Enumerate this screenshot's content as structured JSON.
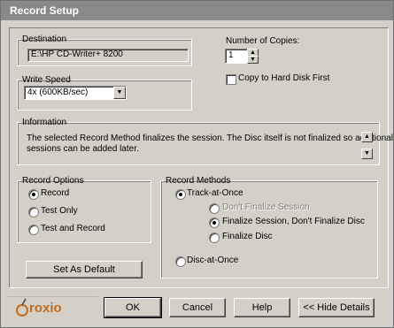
{
  "window": {
    "title": "Record Setup"
  },
  "destination": {
    "label": "Destination",
    "value": "E:\\HP CD-Writer+ 8200"
  },
  "copies": {
    "label": "Number of Copies:",
    "value": "1"
  },
  "write_speed": {
    "label": "Write Speed",
    "selected": "4x (600KB/sec)"
  },
  "copy_first": {
    "label": "Copy to Hard Disk First",
    "checked": false
  },
  "information": {
    "label": "Information",
    "text_line1": "The selected Record Method finalizes the session. The Disc itself is not finalized so additional",
    "text_line2": "sessions can be added later."
  },
  "record_options": {
    "label": "Record Options",
    "items": [
      {
        "label": "Record",
        "selected": true
      },
      {
        "label": "Test Only",
        "selected": false
      },
      {
        "label": "Test and Record",
        "selected": false
      }
    ]
  },
  "record_methods": {
    "label": "Record Methods",
    "track_at_once": {
      "label": "Track-at-Once",
      "selected": true
    },
    "dont_finalize": {
      "label": "Don't Finalize Session",
      "selected": false
    },
    "finalize_session": {
      "label": "Finalize Session, Don't Finalize Disc",
      "selected": true
    },
    "finalize_disc": {
      "label": "Finalize Disc",
      "selected": false
    },
    "disc_at_once": {
      "label": "Disc-at-Once",
      "selected": false
    }
  },
  "buttons": {
    "set_default": "Set As Default",
    "ok": "OK",
    "cancel": "Cancel",
    "help": "Help",
    "hide_details": "<< Hide Details"
  },
  "brand": {
    "logo_text": "roxio"
  },
  "colors": {
    "titlebar": "#898989",
    "face": "#d4d0c8",
    "logo": "#c06a20"
  }
}
